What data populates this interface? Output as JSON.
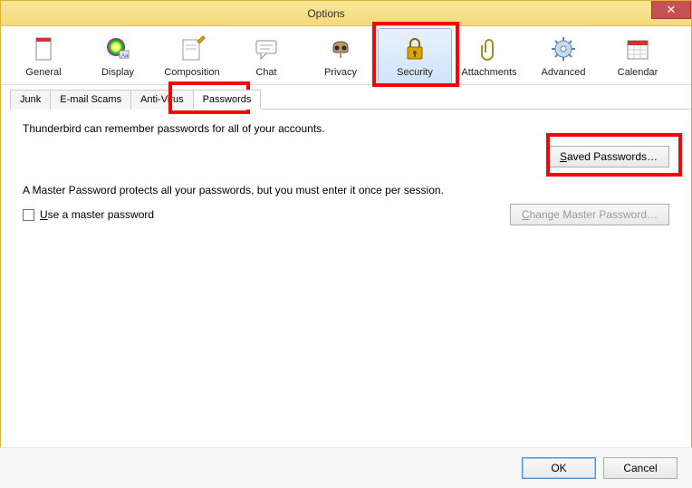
{
  "window": {
    "title": "Options"
  },
  "toolbar": [
    {
      "id": "general",
      "label": "General"
    },
    {
      "id": "display",
      "label": "Display"
    },
    {
      "id": "composition",
      "label": "Composition"
    },
    {
      "id": "chat",
      "label": "Chat"
    },
    {
      "id": "privacy",
      "label": "Privacy"
    },
    {
      "id": "security",
      "label": "Security",
      "selected": true
    },
    {
      "id": "attachments",
      "label": "Attachments"
    },
    {
      "id": "advanced",
      "label": "Advanced"
    },
    {
      "id": "calendar",
      "label": "Calendar"
    }
  ],
  "tabs": {
    "junk": "Junk",
    "scams": "E-mail Scams",
    "antivirus": "Anti-Virus",
    "passwords": "Passwords"
  },
  "content": {
    "remember_text": "Thunderbird can remember passwords for all of your accounts.",
    "saved_btn": "Saved Passwords…",
    "master_text": "A Master Password protects all your passwords, but you must enter it once per session.",
    "use_master_label": "Use a master password",
    "change_master_btn": "Change Master Password…"
  },
  "footer": {
    "ok": "OK",
    "cancel": "Cancel"
  }
}
